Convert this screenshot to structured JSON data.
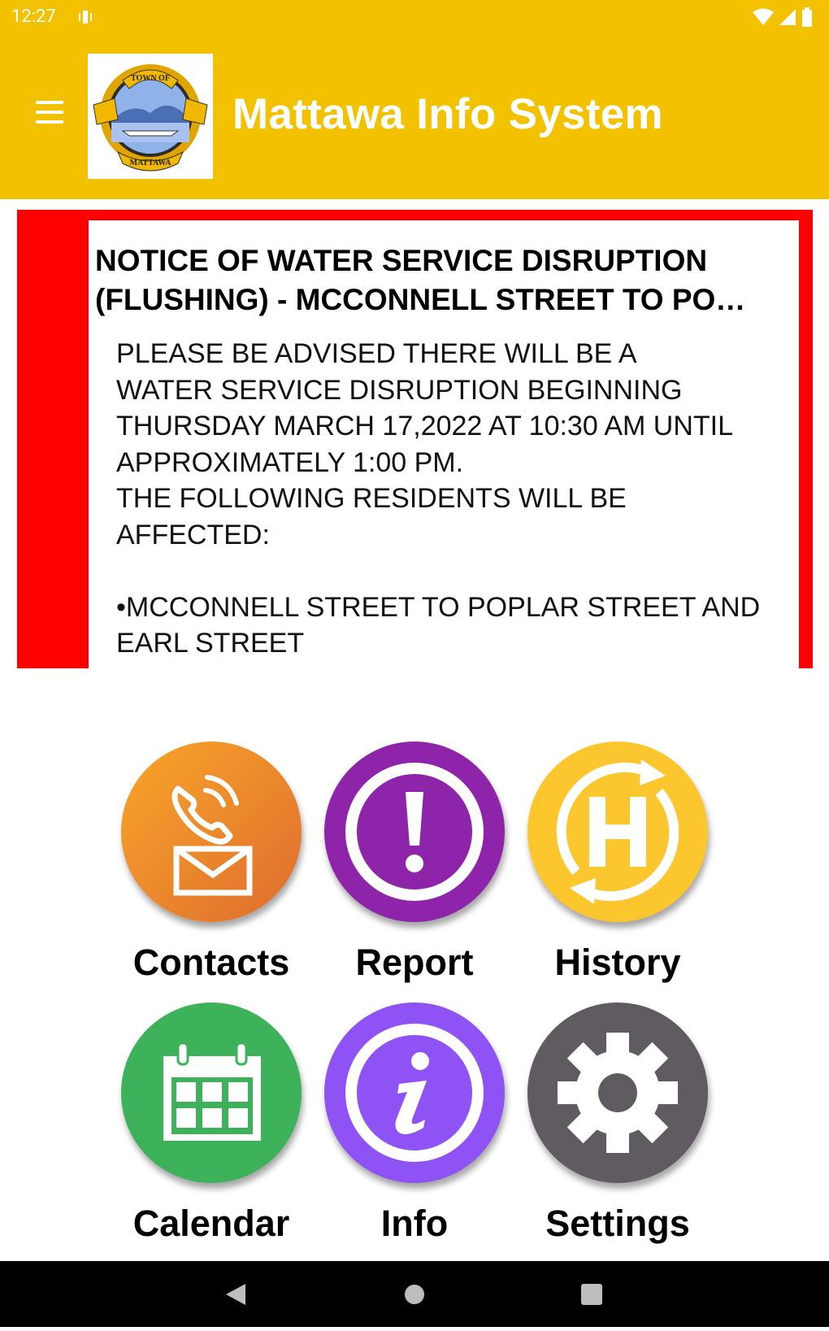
{
  "status_bar": {
    "time": "12:27"
  },
  "app_bar": {
    "title": "Mattawa Info System",
    "logo_text_top": "TOWN OF",
    "logo_text_bottom": "MATTAWA"
  },
  "notice": {
    "title": "NOTICE OF WATER SERVICE DISRUPTION\n(FLUSHING) - MCCONNELL STREET TO PO…",
    "body": "PLEASE BE ADVISED THERE WILL BE A\nWATER SERVICE DISRUPTION BEGINNING\nTHURSDAY MARCH 17,2022 AT 10:30 AM UNTIL\nAPPROXIMATELY 1:00 PM.\nTHE FOLLOWING RESIDENTS WILL BE\nAFFECTED:\n\n•MCCONNELL STREET TO POPLAR STREET AND\nEARL STREET",
    "accent_color": "#ff0000"
  },
  "tiles": [
    {
      "label": "Contacts",
      "icon": "phone-envelope-icon",
      "color": "#ee8526"
    },
    {
      "label": "Report",
      "icon": "exclamation-icon",
      "color": "#8e24aa"
    },
    {
      "label": "History",
      "icon": "history-h-icon",
      "color": "#fcc72e"
    },
    {
      "label": "Calendar",
      "icon": "calendar-icon",
      "color": "#3db25a"
    },
    {
      "label": "Info",
      "icon": "info-icon",
      "color": "#8f52f4"
    },
    {
      "label": "Settings",
      "icon": "gear-icon",
      "color": "#5f5b60"
    }
  ],
  "colors": {
    "brand_yellow": "#f2c200",
    "nav_bar": "#000000"
  }
}
